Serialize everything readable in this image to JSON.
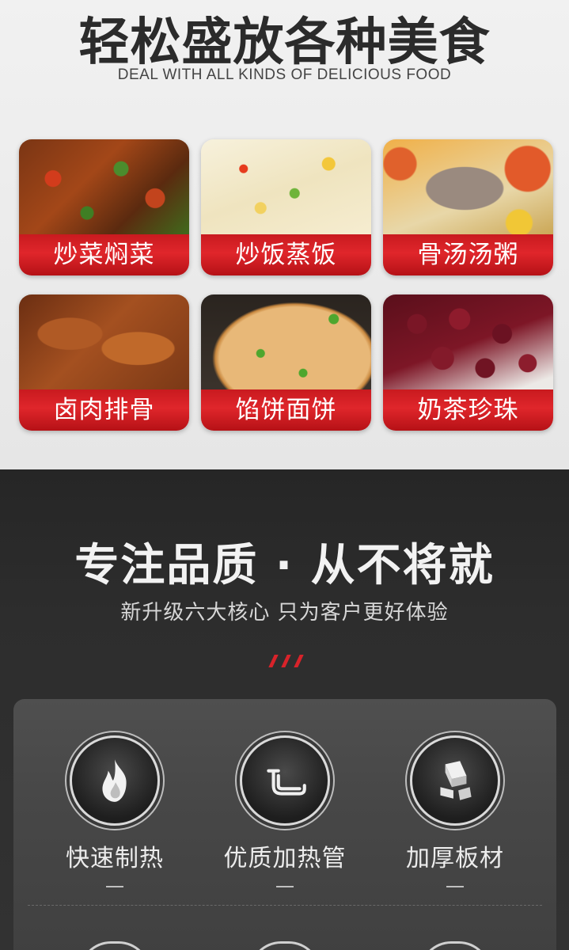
{
  "top": {
    "title": "轻松盛放各种美食",
    "subtitle": "DEAL WITH ALL KINDS OF DELICIOUS FOOD",
    "foods": [
      {
        "label": "炒菜焖菜",
        "icon": "stir-fry-photo"
      },
      {
        "label": "炒饭蒸饭",
        "icon": "fried-rice-photo"
      },
      {
        "label": "骨汤汤粥",
        "icon": "bone-soup-photo"
      },
      {
        "label": "卤肉排骨",
        "icon": "braised-ribs-photo"
      },
      {
        "label": "馅饼面饼",
        "icon": "pancake-photo"
      },
      {
        "label": "奶茶珍珠",
        "icon": "milk-tea-pearls-photo"
      }
    ]
  },
  "quality": {
    "title": "专注品质 · 从不将就",
    "subtitle": "新升级六大核心 只为客户更好体验",
    "features": [
      {
        "label": "快速制热",
        "icon": "flame-icon"
      },
      {
        "label": "优质加热管",
        "icon": "heating-tube-icon"
      },
      {
        "label": "加厚板材",
        "icon": "metal-ingot-icon"
      }
    ]
  },
  "colors": {
    "accent": "#d8232a",
    "dark_bg": "#2d2d2d"
  }
}
